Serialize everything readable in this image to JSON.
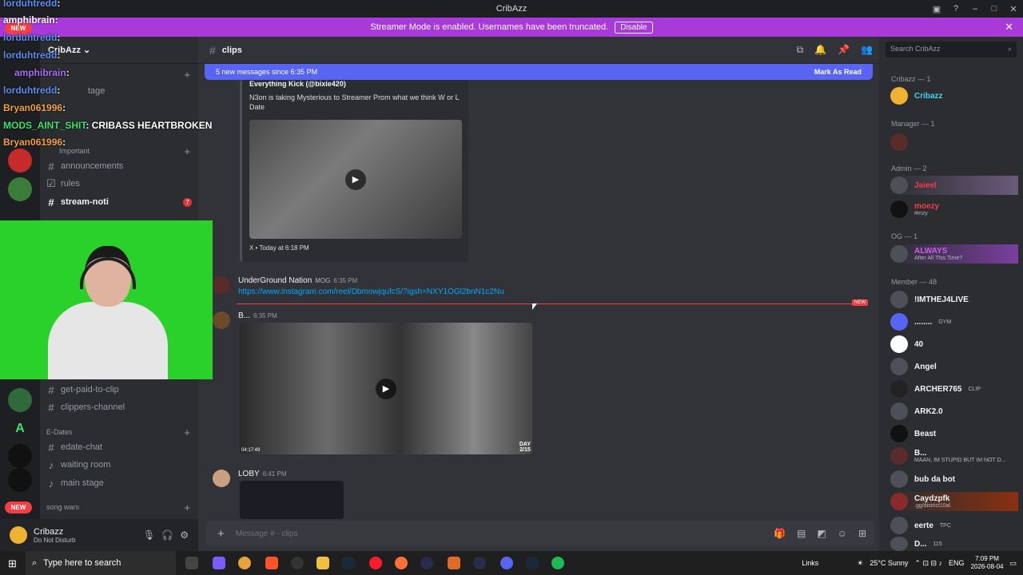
{
  "window": {
    "title": "CribAzz",
    "title_icon": "discord-icon"
  },
  "banner": {
    "text": "Streamer Mode is enabled. Usernames have been truncated.",
    "button": "Disable",
    "color": "#a73ad9"
  },
  "overlay_chat": [
    {
      "user": "lorduhtredd",
      "msg": ":",
      "color": "#5b8def"
    },
    {
      "user": "amphibrain",
      "msg": ":",
      "color": "#ffffff"
    },
    {
      "user": "lorduhtredd",
      "msg": ":",
      "color": "#5b8def"
    },
    {
      "user": "lorduhtredd",
      "msg": ":",
      "color": "#5b8def"
    },
    {
      "user": "amphibrain",
      "msg": ":",
      "color": "#a86cf0"
    },
    {
      "user": "lorduhtredd",
      "msg": ":",
      "color": "#5b8def"
    },
    {
      "user": "Bryan061996",
      "msg": ":",
      "color": "#f0a040"
    },
    {
      "user": "MODS_AINT_SHIT",
      "msg": ": CRIBASS HEARTBROKEN",
      "color": "#3fe06b"
    },
    {
      "user": "Bryan061996",
      "msg": ":",
      "color": "#f0a040"
    }
  ],
  "server": {
    "name": "CribAzz",
    "channel_partial": "tage"
  },
  "categories": {
    "important": "Important",
    "edates": "E-Dates",
    "songwars": "song wars"
  },
  "channels": {
    "announcements": "announcements",
    "rules": "rules",
    "stream_noti": "stream-noti",
    "stream_noti_badge": "7",
    "get_paid": "get-paid-to-clip",
    "clippers": "clippers-channel",
    "edate_chat": "edate-chat",
    "waiting_room": "waiting room",
    "main_stage": "main stage"
  },
  "new_pill": "NEW",
  "user_panel": {
    "name": "Cribazz",
    "status": "Do Not Disturb"
  },
  "header": {
    "channel": "clips",
    "search_placeholder": "Search CribAzz"
  },
  "new_messages": {
    "text": "5 new messages since 6:35 PM",
    "action": "Mark As Read"
  },
  "embed": {
    "author": "Everything Kick (@bixie420)",
    "description": "N3on is taking Mysterious to Streamer Prom what we think W or L Date",
    "footer": "X • Today at 6:18 PM"
  },
  "messages": [
    {
      "author": "UnderGround Nation",
      "tag": "MOG",
      "time": "6:35 PM",
      "link": "https://www.instagram.com/reel/DbmowjqufcS/?igsh=NXY1OGl2bnN1c2Nu"
    },
    {
      "author": "B...",
      "time": "6:35 PM",
      "video_duration": "04:17:49",
      "video_day": "DAY",
      "video_day_num": "2/15"
    },
    {
      "author": "LOBY",
      "time": "6:41 PM"
    }
  ],
  "divider_label": "NEW",
  "composer": {
    "placeholder": "Message #",
    "channel": "clips"
  },
  "member_groups": [
    {
      "label": "Cribazz — 1",
      "members": [
        {
          "name": "Cribazz",
          "status": "",
          "color": "#3dd6f5"
        }
      ]
    },
    {
      "label": "Manager — 1",
      "members": [
        {
          "name": "",
          "status": "",
          "color": "#f2f3f5"
        }
      ]
    },
    {
      "label": "Admin — 2",
      "members": [
        {
          "name": "Jaieel",
          "status": "",
          "color": "#f23f43"
        },
        {
          "name": "moezy",
          "status": "#mzy",
          "color": "#f23f43"
        }
      ]
    },
    {
      "label": "OG — 1",
      "members": [
        {
          "name": "ALWAYS",
          "status": "After All This Time?",
          "color": "#d060f0"
        }
      ]
    },
    {
      "label": "Member — 48",
      "members": [
        {
          "name": "!IMTHEJ4LIVE",
          "status": "",
          "color": "#f2f3f5"
        },
        {
          "name": "........",
          "status": "GYM",
          "color": "#f2f3f5"
        },
        {
          "name": "40",
          "status": "",
          "color": "#f2f3f5"
        },
        {
          "name": "Angel",
          "status": "",
          "color": "#f2f3f5"
        },
        {
          "name": "ARCHER765",
          "status": "CLIP",
          "color": "#f2f3f5"
        },
        {
          "name": "ARK2.0",
          "status": "",
          "color": "#f2f3f5"
        },
        {
          "name": "Beast",
          "status": "",
          "color": "#f2f3f5"
        },
        {
          "name": "B...",
          "status": "MAAN, IM STUPID BUT IM NOT D...",
          "color": "#f2f3f5"
        },
        {
          "name": "bub da bot",
          "status": "",
          "color": "#f2f3f5"
        },
        {
          "name": "Caydzpfk",
          "status": ".gg/district10al",
          "color": "#f2f3f5"
        },
        {
          "name": "eerte",
          "status": "TPC",
          "color": "#f2f3f5"
        },
        {
          "name": "D...",
          "status": "115",
          "color": "#f2f3f5"
        }
      ]
    }
  ],
  "taskbar": {
    "search": "Type here to search",
    "links": "Links",
    "weather": "25°C Sunny",
    "lang": "ENG",
    "time": "7:09 PM",
    "date": "2026-08-04"
  }
}
